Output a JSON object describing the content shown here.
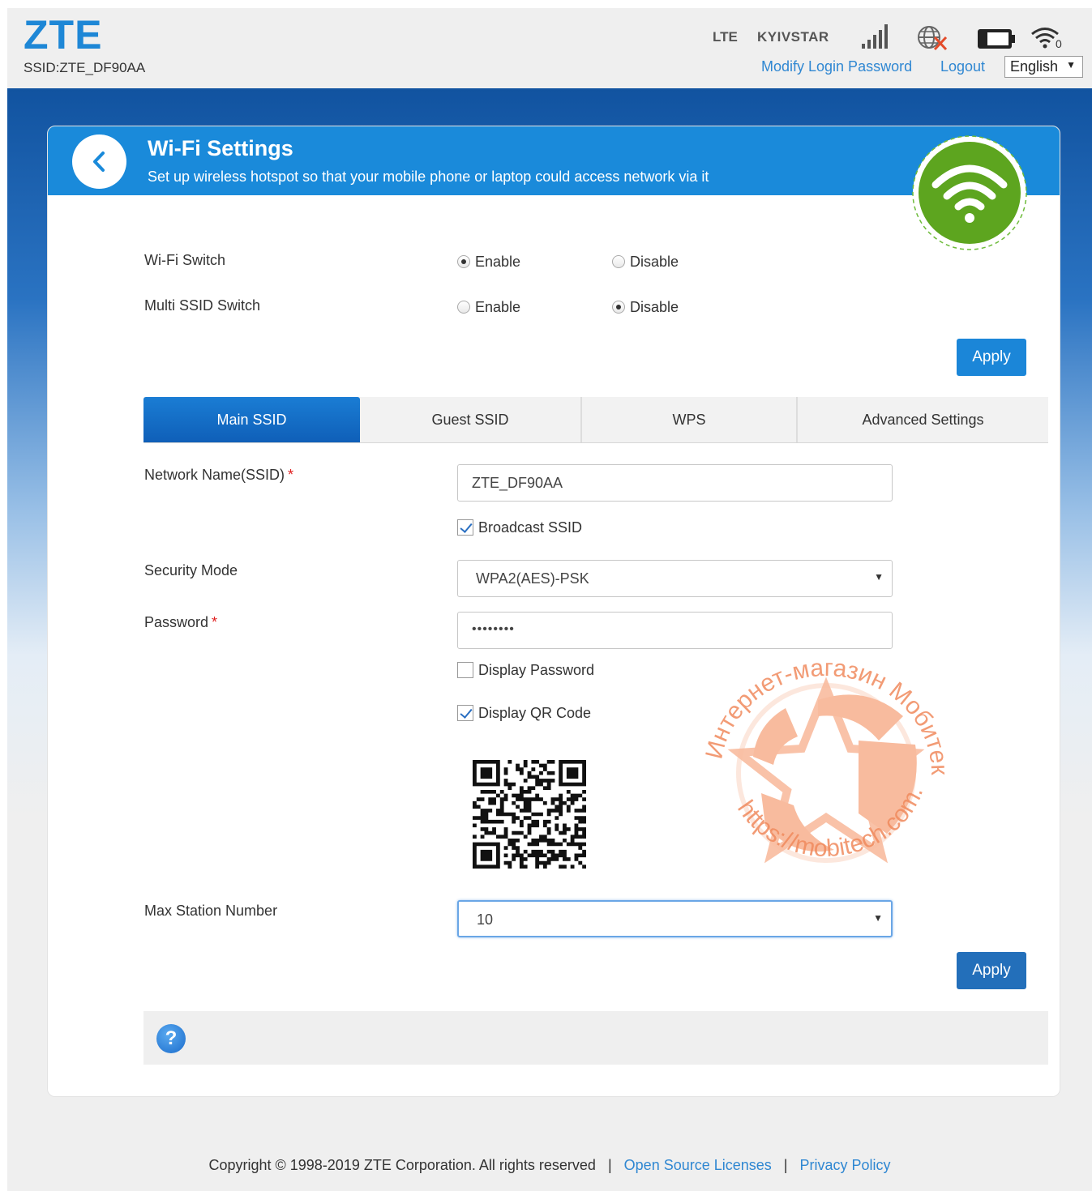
{
  "header": {
    "logo_text": "ZTE",
    "ssid_label": "SSID:ZTE_DF90AA",
    "network_type": "LTE",
    "carrier": "KYIVSTAR",
    "wifi_clients": "0",
    "modify_password_link": "Modify Login Password",
    "logout_link": "Logout",
    "language": "English",
    "icons": [
      "signal-icon",
      "globe-disconnected-icon",
      "battery-icon",
      "wifi-status-icon"
    ]
  },
  "page": {
    "title": "Wi-Fi Settings",
    "subtitle": "Set up wireless hotspot so that your mobile phone or laptop could access network via it"
  },
  "wifi_switch": {
    "label": "Wi-Fi Switch",
    "enable": "Enable",
    "disable": "Disable",
    "selected": "Enable"
  },
  "multi_ssid": {
    "label": "Multi SSID Switch",
    "enable": "Enable",
    "disable": "Disable",
    "selected": "Disable"
  },
  "apply_label": "Apply",
  "tabs": [
    {
      "label": "Main SSID",
      "active": true
    },
    {
      "label": "Guest SSID",
      "active": false
    },
    {
      "label": "WPS",
      "active": false
    },
    {
      "label": "Advanced Settings",
      "active": false
    }
  ],
  "form": {
    "ssid_label": "Network Name(SSID)",
    "ssid_value": "ZTE_DF90AA",
    "required_mark": "*",
    "broadcast_label": "Broadcast SSID",
    "broadcast_checked": true,
    "security_label": "Security Mode",
    "security_value": "WPA2(AES)-PSK",
    "password_label": "Password",
    "password_value": "••••••••",
    "display_password_label": "Display Password",
    "display_password_checked": false,
    "display_qr_label": "Display QR Code",
    "display_qr_checked": true,
    "max_station_label": "Max Station Number",
    "max_station_value": "10"
  },
  "watermark": {
    "top_text": "Интернет-магазин Мобитек",
    "bottom_text": "https://mobitech.com.ua",
    "color": "#f6a57e"
  },
  "footer": {
    "copyright": "Copyright © 1998-2019 ZTE Corporation. All rights reserved",
    "separator": "|",
    "open_source": "Open Source Licenses",
    "privacy": "Privacy Policy"
  },
  "colors": {
    "brand_blue": "#1a8ada",
    "link": "#2f87d2",
    "wifi_green": "#5da51f"
  }
}
